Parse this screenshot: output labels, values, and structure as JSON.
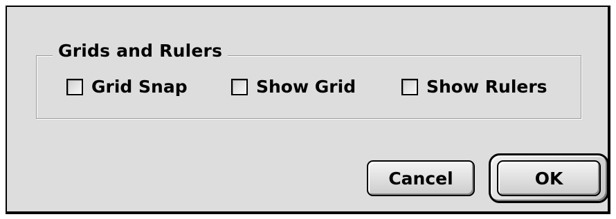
{
  "dialog": {
    "group": {
      "title": "Grids and Rulers",
      "options": [
        {
          "label": "Grid Snap",
          "checked": false
        },
        {
          "label": "Show Grid",
          "checked": false
        },
        {
          "label": "Show Rulers",
          "checked": false
        }
      ]
    },
    "buttons": {
      "cancel_label": "Cancel",
      "ok_label": "OK",
      "default": "OK"
    }
  }
}
